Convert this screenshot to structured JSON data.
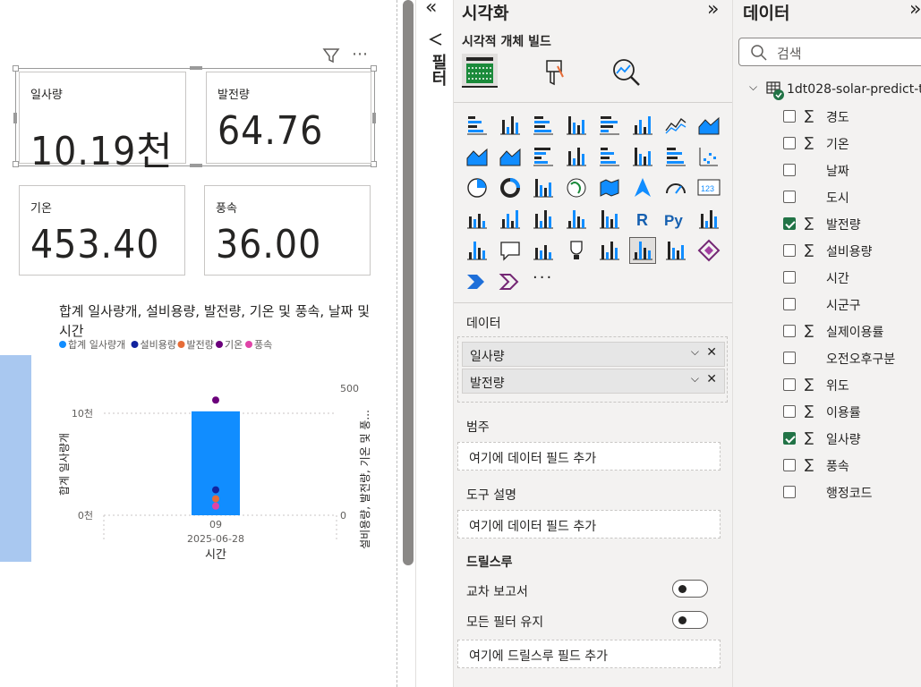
{
  "canvas": {
    "cards": [
      {
        "label": "일사량",
        "value": "10.19천"
      },
      {
        "label": "발전량",
        "value": "64.76"
      },
      {
        "label": "기온",
        "value": "453.40"
      },
      {
        "label": "풍속",
        "value": "36.00"
      }
    ],
    "visual_icons": {
      "filter": "filter-icon",
      "more": "more-options-icon"
    }
  },
  "chart_data": {
    "type": "bar",
    "title": "합계 일사량개, 설비용량, 발전량, 기온 및 풍속, 날짜 및 시간",
    "legend": [
      {
        "name": "합계 일사량개",
        "color": "#118dff"
      },
      {
        "name": "설비용량",
        "color": "#12239e"
      },
      {
        "name": "발전량",
        "color": "#e66c37"
      },
      {
        "name": "기온",
        "color": "#6b007b"
      },
      {
        "name": "풍속",
        "color": "#e044a7"
      }
    ],
    "categories": [
      "09"
    ],
    "category_sub": "2025-06-28",
    "xlabel": "시간",
    "ylabel": "합계 일사량개",
    "y2label": "설비용량, 발전량, 기온 및 풍...",
    "yticks": [
      "10천",
      "0천"
    ],
    "y2ticks": [
      "500",
      "0"
    ],
    "ylim": [
      0,
      10000
    ],
    "y2lim": [
      0,
      500
    ],
    "series": [
      {
        "name": "합계 일사량개",
        "kind": "bar",
        "values": [
          10190
        ]
      },
      {
        "name": "설비용량",
        "kind": "point",
        "values": [
          100
        ]
      },
      {
        "name": "발전량",
        "kind": "point",
        "values": [
          64.76
        ]
      },
      {
        "name": "기온",
        "kind": "point",
        "values": [
          453.4
        ]
      },
      {
        "name": "풍속",
        "kind": "point",
        "values": [
          36
        ]
      }
    ]
  },
  "rail": {
    "label": "필터"
  },
  "viz": {
    "title": "시각화",
    "subtitle": "시각적 개체 빌드",
    "more": "···",
    "data_label": "데이터",
    "wells": [
      "일사량",
      "발전량"
    ],
    "category_label": "범주",
    "category_placeholder": "여기에 데이터 필드 추가",
    "tooltip_label": "도구 설명",
    "tooltip_placeholder": "여기에 데이터 필드 추가",
    "drill_label": "드릴스루",
    "cross_report": "교차 보고서",
    "keep_filters": "모든 필터 유지",
    "drill_placeholder": "여기에 드릴스루 필드 추가"
  },
  "data": {
    "title": "데이터",
    "search_placeholder": "검색",
    "table": "1dt028-solar-predict-t...",
    "fields": [
      {
        "name": "경도",
        "sigma": true,
        "checked": false
      },
      {
        "name": "기온",
        "sigma": true,
        "checked": false
      },
      {
        "name": "날짜",
        "sigma": false,
        "checked": false
      },
      {
        "name": "도시",
        "sigma": false,
        "checked": false
      },
      {
        "name": "발전량",
        "sigma": true,
        "checked": true
      },
      {
        "name": "설비용량",
        "sigma": true,
        "checked": false
      },
      {
        "name": "시간",
        "sigma": false,
        "checked": false
      },
      {
        "name": "시군구",
        "sigma": false,
        "checked": false
      },
      {
        "name": "실제이용률",
        "sigma": true,
        "checked": false
      },
      {
        "name": "오전오후구분",
        "sigma": false,
        "checked": false
      },
      {
        "name": "위도",
        "sigma": true,
        "checked": false
      },
      {
        "name": "이용률",
        "sigma": true,
        "checked": false
      },
      {
        "name": "일사량",
        "sigma": true,
        "checked": true
      },
      {
        "name": "풍속",
        "sigma": true,
        "checked": false
      },
      {
        "name": "행정코드",
        "sigma": false,
        "checked": false
      }
    ]
  }
}
